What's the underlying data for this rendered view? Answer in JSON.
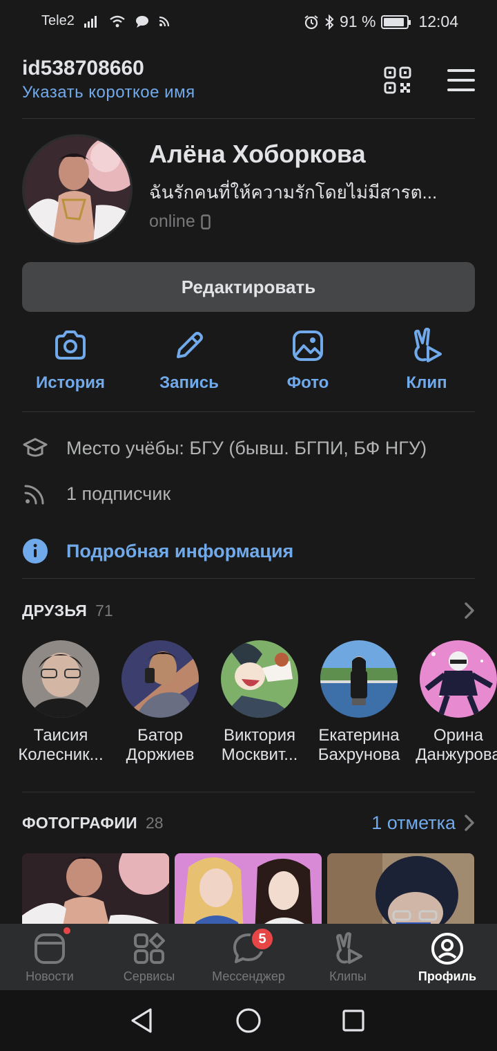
{
  "status_bar": {
    "carrier": "Tele2",
    "battery_text": "91 %",
    "battery_level": 0.91,
    "time": "12:04",
    "icons": [
      "signal-icon",
      "wifi-icon",
      "chat-bubble-icon",
      "cast-icon",
      "alarm-icon",
      "bluetooth-icon",
      "battery-icon"
    ]
  },
  "header": {
    "user_id": "id538708660",
    "short_name_link": "Указать короткое имя",
    "icons": [
      "qr-code-icon",
      "menu-icon"
    ]
  },
  "profile": {
    "name": "Алёна Хоборкова",
    "status": "ฉันรักคนที่ให้ความรักโดยไม่มีสารต...",
    "online": "online",
    "edit_label": "Редактировать"
  },
  "actions": [
    {
      "label": "История",
      "icon": "camera-icon"
    },
    {
      "label": "Запись",
      "icon": "pencil-icon"
    },
    {
      "label": "Фото",
      "icon": "image-icon"
    },
    {
      "label": "Клип",
      "icon": "clip-icon"
    }
  ],
  "info": {
    "education": "Место учёбы: БГУ (бывш. БГПИ, БФ НГУ)",
    "followers": "1 подписчик",
    "details_link": "Подробная информация"
  },
  "friends": {
    "title": "ДРУЗЬЯ",
    "count": "71",
    "items": [
      {
        "line1": "Таисия",
        "line2": "Колесник..."
      },
      {
        "line1": "Батор",
        "line2": "Доржиев"
      },
      {
        "line1": "Виктория",
        "line2": "Москвит..."
      },
      {
        "line1": "Екатерина",
        "line2": "Бахрунова"
      },
      {
        "line1": "Орина",
        "line2": "Данжурова"
      }
    ]
  },
  "photos": {
    "title": "ФОТОГРАФИИ",
    "count": "28",
    "marks_link": "1 отметка"
  },
  "tabbar": {
    "tabs": [
      {
        "label": "Новости",
        "icon": "news-icon"
      },
      {
        "label": "Сервисы",
        "icon": "services-icon"
      },
      {
        "label": "Мессенджер",
        "icon": "messenger-icon",
        "badge": "5"
      },
      {
        "label": "Клипы",
        "icon": "clips-icon"
      },
      {
        "label": "Профиль",
        "icon": "profile-icon",
        "active": true
      }
    ]
  },
  "colors": {
    "background": "#19191a",
    "accent": "#71aaeb",
    "tabbar": "#2c2d2e",
    "badge": "#e64646"
  }
}
